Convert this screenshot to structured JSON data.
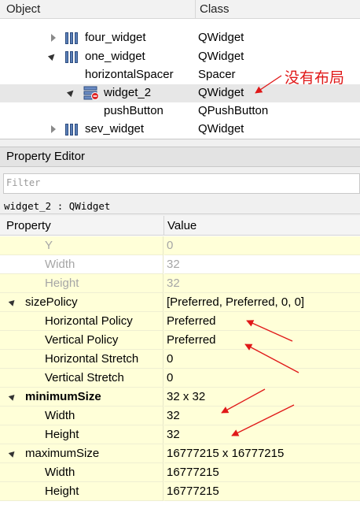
{
  "object_inspector": {
    "col_object": "Object",
    "col_class": "Class",
    "rows": [
      {
        "name": "four_widget",
        "class": "QWidget"
      },
      {
        "name": "one_widget",
        "class": "QWidget"
      },
      {
        "name": "horizontalSpacer",
        "class": "Spacer"
      },
      {
        "name": "widget_2",
        "class": "QWidget"
      },
      {
        "name": "pushButton",
        "class": "QPushButton"
      },
      {
        "name": "sev_widget",
        "class": "QWidget"
      }
    ]
  },
  "annotation": {
    "text": "没有布局",
    "color": "#e01818"
  },
  "property_editor": {
    "title": "Property Editor",
    "filter_placeholder": "Filter",
    "object_line": "widget_2 : QWidget",
    "col_property": "Property",
    "col_value": "Value",
    "rows": [
      {
        "key": "Y",
        "value": "0"
      },
      {
        "key": "Width",
        "value": "32"
      },
      {
        "key": "Height",
        "value": "32"
      },
      {
        "key": "sizePolicy",
        "value": "[Preferred, Preferred, 0, 0]"
      },
      {
        "key": "Horizontal Policy",
        "value": "Preferred"
      },
      {
        "key": "Vertical Policy",
        "value": "Preferred"
      },
      {
        "key": "Horizontal Stretch",
        "value": "0"
      },
      {
        "key": "Vertical Stretch",
        "value": "0"
      },
      {
        "key": "minimumSize",
        "value": "32 x 32"
      },
      {
        "key": "Width",
        "value": "32"
      },
      {
        "key": "Height",
        "value": "32"
      },
      {
        "key": "maximumSize",
        "value": "16777215 x 16777215"
      },
      {
        "key": "Width",
        "value": "16777215"
      },
      {
        "key": "Height",
        "value": "16777215"
      }
    ]
  },
  "colors": {
    "accent_red": "#e01818",
    "property_row_yellow": "#ffffd8",
    "selected_row": "#e7e7e7"
  }
}
